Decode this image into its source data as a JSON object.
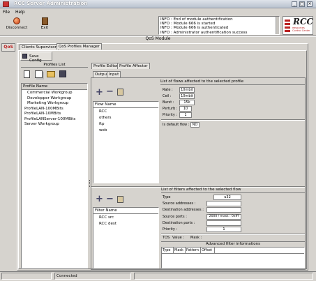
{
  "window": {
    "title": "RCC Server Administration"
  },
  "menu": [
    "File",
    "Help"
  ],
  "toolbar": {
    "disconnect": "Disconnect",
    "exit": "Exit"
  },
  "log": [
    "INFO : End of module authentification",
    "INFO : Module 666 is started",
    "INFO : Module 666 is authenticated",
    "INFO : Administrator authentification success"
  ],
  "logo": {
    "text": "RCC",
    "sub": "Resources Control Center"
  },
  "module": {
    "title": "QoS Module",
    "side_label": "QoS"
  },
  "tabs": {
    "clients": "Clients Supervisor",
    "qos": "QoS Profiles Manager"
  },
  "save_config": "Save Config",
  "profiles": {
    "title": "Profiles List",
    "header": "Profile Name",
    "items": [
      "Commercial Workgroup",
      "Developper Workgroup",
      "Marketing Workgroup",
      "ProfileLAN-100MBits",
      "ProfileLAN-10MBits",
      "ProfileLANServer-100MBits",
      "Server Workgroup"
    ]
  },
  "editor_tabs": {
    "editor": "Profile Editor",
    "affector": "Profile Affector"
  },
  "io_tabs": {
    "output": "Output",
    "input": "Input"
  },
  "flows": {
    "title": "List of flows affected to the selected profile",
    "header": "Flow Name",
    "items": [
      "RCC",
      "others",
      "ftp",
      "web"
    ]
  },
  "flow_params": {
    "rate_label": "Rate :",
    "rate": "10mbit",
    "ceil_label": "Ceil :",
    "ceil": "10mbit",
    "burst_label": "Burst :",
    "burst": "15k",
    "perturb_label": "Perturb :",
    "perturb": "10",
    "priority_label": "Priority :",
    "priority": "1",
    "default_label": "Is default flow :",
    "default": "NO"
  },
  "filters": {
    "title": "List of filters affected to the selected flow",
    "header": "Filter Name",
    "items": [
      "RCC src",
      "RCC dest"
    ]
  },
  "filter_params": {
    "type_label": "Type",
    "type": "u32",
    "src_label": "Source addresses :",
    "dst_label": "Destination addresses :",
    "sport_label": "Source ports :",
    "sport": "2000 / mask : 0xfff",
    "dport_label": "Destination ports :",
    "prio_label": "Priority :",
    "prio": "1",
    "tos_label": "TOS",
    "value_label": "Value :",
    "mask_label": "Mask :",
    "adv_title": "Advanced filter informations",
    "adv_cols": [
      "Type",
      "Mask",
      "Pattern",
      "Offset"
    ]
  },
  "status": "Connected"
}
